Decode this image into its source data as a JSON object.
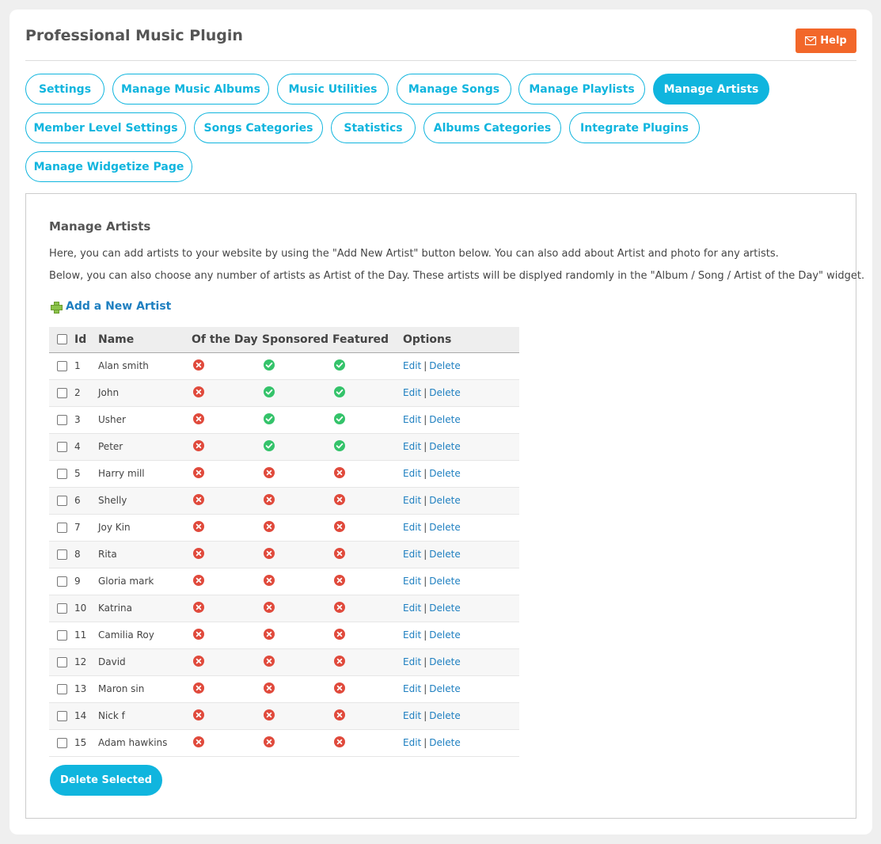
{
  "header": {
    "title": "Professional Music Plugin",
    "help_label": "Help"
  },
  "tabs": [
    {
      "label": "Settings",
      "active": false
    },
    {
      "label": "Manage Music Albums",
      "active": false
    },
    {
      "label": "Music Utilities",
      "active": false
    },
    {
      "label": "Manage Songs",
      "active": false
    },
    {
      "label": "Manage Playlists",
      "active": false
    },
    {
      "label": "Manage Artists",
      "active": true
    },
    {
      "label": "Member Level Settings",
      "active": false
    },
    {
      "label": "Songs Categories",
      "active": false
    },
    {
      "label": "Statistics",
      "active": false
    },
    {
      "label": "Albums Categories",
      "active": false
    },
    {
      "label": "Integrate Plugins",
      "active": false
    },
    {
      "label": "Manage Widgetize Page",
      "active": false
    }
  ],
  "panel": {
    "title": "Manage Artists",
    "description_1": "Here, you can add artists to your website by using the \"Add New Artist\" button below. You can also add about Artist and photo for any artists.",
    "description_2": "Below, you can also choose any number of artists as Artist of the Day. These artists will be displyed randomly in the \"Album / Song / Artist of the Day\" widget.",
    "add_link": "Add a New Artist",
    "delete_selected": "Delete Selected"
  },
  "table": {
    "columns": {
      "id": "Id",
      "name": "Name",
      "of_the_day": "Of the Day",
      "sponsored": "Sponsored",
      "featured": "Featured",
      "options": "Options"
    },
    "edit_label": "Edit",
    "delete_label": "Delete",
    "separator": "|",
    "rows": [
      {
        "id": "1",
        "name": "Alan smith",
        "of_the_day": false,
        "sponsored": true,
        "featured": true
      },
      {
        "id": "2",
        "name": "John",
        "of_the_day": false,
        "sponsored": true,
        "featured": true
      },
      {
        "id": "3",
        "name": "Usher",
        "of_the_day": false,
        "sponsored": true,
        "featured": true
      },
      {
        "id": "4",
        "name": "Peter",
        "of_the_day": false,
        "sponsored": true,
        "featured": true
      },
      {
        "id": "5",
        "name": "Harry mill",
        "of_the_day": false,
        "sponsored": false,
        "featured": false
      },
      {
        "id": "6",
        "name": "Shelly",
        "of_the_day": false,
        "sponsored": false,
        "featured": false
      },
      {
        "id": "7",
        "name": "Joy Kin",
        "of_the_day": false,
        "sponsored": false,
        "featured": false
      },
      {
        "id": "8",
        "name": "Rita",
        "of_the_day": false,
        "sponsored": false,
        "featured": false
      },
      {
        "id": "9",
        "name": "Gloria mark",
        "of_the_day": false,
        "sponsored": false,
        "featured": false
      },
      {
        "id": "10",
        "name": "Katrina",
        "of_the_day": false,
        "sponsored": false,
        "featured": false
      },
      {
        "id": "11",
        "name": "Camilia Roy",
        "of_the_day": false,
        "sponsored": false,
        "featured": false
      },
      {
        "id": "12",
        "name": "David",
        "of_the_day": false,
        "sponsored": false,
        "featured": false
      },
      {
        "id": "13",
        "name": "Maron sin",
        "of_the_day": false,
        "sponsored": false,
        "featured": false
      },
      {
        "id": "14",
        "name": "Nick f",
        "of_the_day": false,
        "sponsored": false,
        "featured": false
      },
      {
        "id": "15",
        "name": "Adam hawkins",
        "of_the_day": false,
        "sponsored": false,
        "featured": false
      }
    ]
  },
  "colors": {
    "accent": "#10b5de",
    "help": "#f2672a",
    "link": "#1e7fc0",
    "yes": "#34c36a",
    "no": "#e04a3c"
  }
}
